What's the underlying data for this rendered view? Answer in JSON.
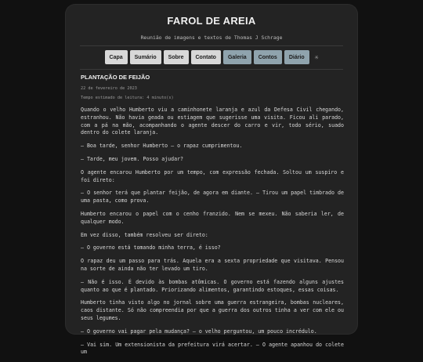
{
  "site": {
    "title": "FAROL DE AREIA",
    "subtitle": "Reunião de imagens e textos de Thomas J Schrage"
  },
  "nav": {
    "items": [
      {
        "label": "Capa",
        "style": "light"
      },
      {
        "label": "Sumário",
        "style": "light"
      },
      {
        "label": "Sobre",
        "style": "light"
      },
      {
        "label": "Contato",
        "style": "light"
      },
      {
        "label": "Galeria",
        "style": "accent"
      },
      {
        "label": "Contos",
        "style": "accent"
      },
      {
        "label": "Diário",
        "style": "accent"
      }
    ],
    "theme_icon": "sun-icon"
  },
  "colors": {
    "background": "#111111",
    "card": "#232323",
    "nav_light": "#d8d8d8",
    "nav_accent": "#8fa3ad",
    "text": "#d9d9d9"
  },
  "post": {
    "title": "PLANTAÇÃO DE FEIJÃO",
    "date": "22 de fevereiro de 2023",
    "read_time": "Tempo estimado de leitura: 4 minuto(s)",
    "paragraphs": [
      "Quando o velho Humberto viu a caminhonete laranja e azul da Defesa Civil chegando, estranhou. Não havia geada ou estiagem que sugerisse uma visita. Ficou ali parado, com a pá na mão, acompanhando o agente descer do carro e vir, todo sério, suado dentro do colete laranja.",
      "– Boa tarde, senhor Humberto – o rapaz cumprimentou.",
      "– Tarde, meu jovem. Posso ajudar?",
      "O agente encarou Humberto por um tempo, com expressão fechada. Soltou um suspiro e foi direto:",
      "– O senhor terá que plantar feijão, de agora em diante. – Tirou um papel timbrado de uma pasta, como prova.",
      "Humberto encarou o papel com o cenho franzido. Nem se mexeu. Não saberia ler, de qualquer modo.",
      "Em vez disso, também resolveu ser direto:",
      "– O governo está tomando minha terra, é isso?",
      "O rapaz deu um passo para trás. Aquela era a sexta propriedade que visitava. Pensou na sorte de ainda não ter levado um tiro.",
      "– Não é isso. É devido às bombas atômicas. O governo está fazendo alguns ajustes quanto ao que é plantado. Priorizando alimentos, garantindo estoques, essas coisas.",
      "Humberto tinha visto algo no jornal sobre uma guerra estrangeira, bombas nucleares, caos distante. Só não compreendia por que a guerra dos outros tinha a ver com ele ou seus legumes.",
      "– O governo vai pagar pela mudança? – o velho perguntou, um pouco incrédulo.",
      "– Vai sim. Um extensionista da prefeitura virá acertar. – O agente apanhou do colete um"
    ]
  }
}
